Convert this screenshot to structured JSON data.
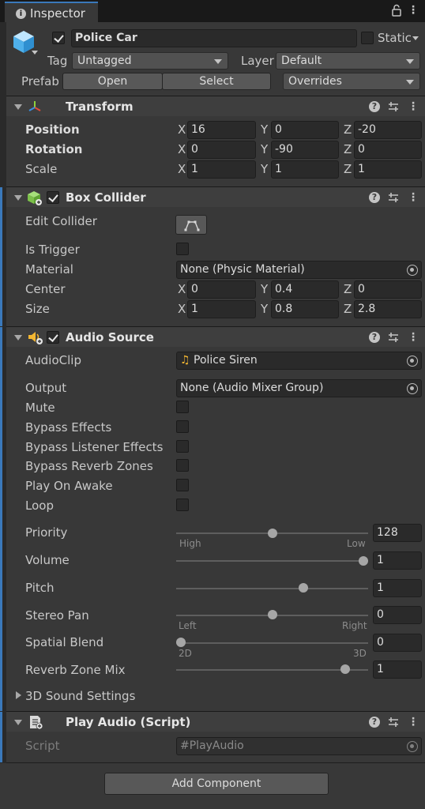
{
  "tab": {
    "title": "Inspector"
  },
  "object": {
    "name": "Police Car",
    "active": true,
    "static_label": "Static",
    "static_checked": false
  },
  "tag": {
    "label": "Tag",
    "value": "Untagged"
  },
  "layer": {
    "label": "Layer",
    "value": "Default"
  },
  "prefab": {
    "label": "Prefab",
    "open": "Open",
    "select": "Select",
    "overrides": "Overrides"
  },
  "transform": {
    "title": "Transform",
    "rows": [
      {
        "label": "Position",
        "x": "16",
        "y": "0",
        "z": "-20"
      },
      {
        "label": "Rotation",
        "x": "0",
        "y": "-90",
        "z": "0"
      },
      {
        "label": "Scale",
        "x": "1",
        "y": "1",
        "z": "1"
      }
    ]
  },
  "box_collider": {
    "title": "Box Collider",
    "enabled": true,
    "edit_collider": "Edit Collider",
    "is_trigger": "Is Trigger",
    "material_label": "Material",
    "material_value": "None (Physic Material)",
    "center": {
      "label": "Center",
      "x": "0",
      "y": "0.4",
      "z": "0"
    },
    "size": {
      "label": "Size",
      "x": "1",
      "y": "0.8",
      "z": "2.8"
    }
  },
  "axes": {
    "x": "X",
    "y": "Y",
    "z": "Z"
  },
  "audio_source": {
    "title": "Audio Source",
    "enabled": true,
    "audioclip_label": "AudioClip",
    "audioclip_value": "Police Siren",
    "output_label": "Output",
    "output_value": "None (Audio Mixer Group)",
    "toggles": [
      "Mute",
      "Bypass Effects",
      "Bypass Listener Effects",
      "Bypass Reverb Zones",
      "Play On Awake",
      "Loop"
    ],
    "sliders": [
      {
        "label": "Priority",
        "value": "128",
        "fraction": 0.5,
        "left": "High",
        "right": "Low"
      },
      {
        "label": "Volume",
        "value": "1",
        "fraction": 1.0
      },
      {
        "label": "Pitch",
        "value": "1",
        "fraction": 0.67
      },
      {
        "label": "Stereo Pan",
        "value": "0",
        "fraction": 0.5,
        "left": "Left",
        "right": "Right"
      },
      {
        "label": "Spatial Blend",
        "value": "0",
        "fraction": 0.0,
        "left": "2D",
        "right": "3D"
      },
      {
        "label": "Reverb Zone Mix",
        "value": "1",
        "fraction": 0.9
      }
    ],
    "sound_settings": "3D Sound Settings"
  },
  "play_audio": {
    "title": "Play Audio (Script)",
    "script_label": "Script",
    "script_value": "PlayAudio"
  },
  "add_component": "Add Component",
  "colors": {
    "accent": "#3a79bb",
    "background": "#383838",
    "field": "#2a2a2a"
  }
}
